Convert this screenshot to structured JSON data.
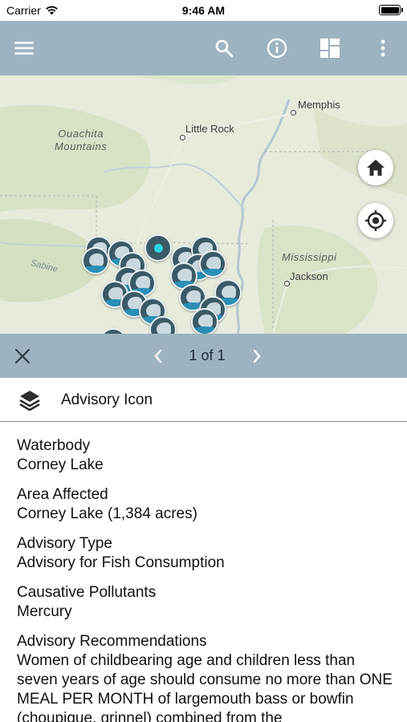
{
  "status_bar": {
    "carrier": "Carrier",
    "time": "9:46 AM"
  },
  "toolbar": {
    "menu_icon": "hamburger-icon",
    "search_icon": "search-icon",
    "info_icon": "info-icon",
    "basemap_icon": "layout-grid-icon",
    "more_icon": "more-vertical-icon",
    "background_color": "#9db3c0"
  },
  "map": {
    "labels": {
      "memphis": "Memphis",
      "little_rock": "Little Rock",
      "ouachita_line1": "Ouachita",
      "ouachita_line2": "Mountains",
      "mississippi": "Mississippi",
      "jackson": "Jackson",
      "sabine": "Sabine"
    },
    "home_button_icon": "home-icon",
    "locate_button_icon": "crosshair-icon",
    "marker_icon": "fish-advisory-icon",
    "selected_marker_color": "#2ed3e0"
  },
  "popup": {
    "counter": "1 of 1",
    "close_icon": "close-icon",
    "prev_icon": "chevron-left-icon",
    "next_icon": "chevron-right-icon",
    "layer_icon": "layers-icon",
    "layer_title": "Advisory Icon"
  },
  "attributes": [
    {
      "label": "Waterbody",
      "value": "Corney Lake"
    },
    {
      "label": "Area Affected",
      "value": "Corney Lake (1,384 acres)"
    },
    {
      "label": "Advisory Type",
      "value": "Advisory for Fish Consumption"
    },
    {
      "label": "Causative Pollutants",
      "value": "Mercury"
    },
    {
      "label": "Advisory Recommendations",
      "value": "Women of childbearing age and children less than seven years of age should consume no more than ONE MEAL PER MONTH of largemouth bass or bowfin (choupique, grinnel) combined from the"
    }
  ]
}
